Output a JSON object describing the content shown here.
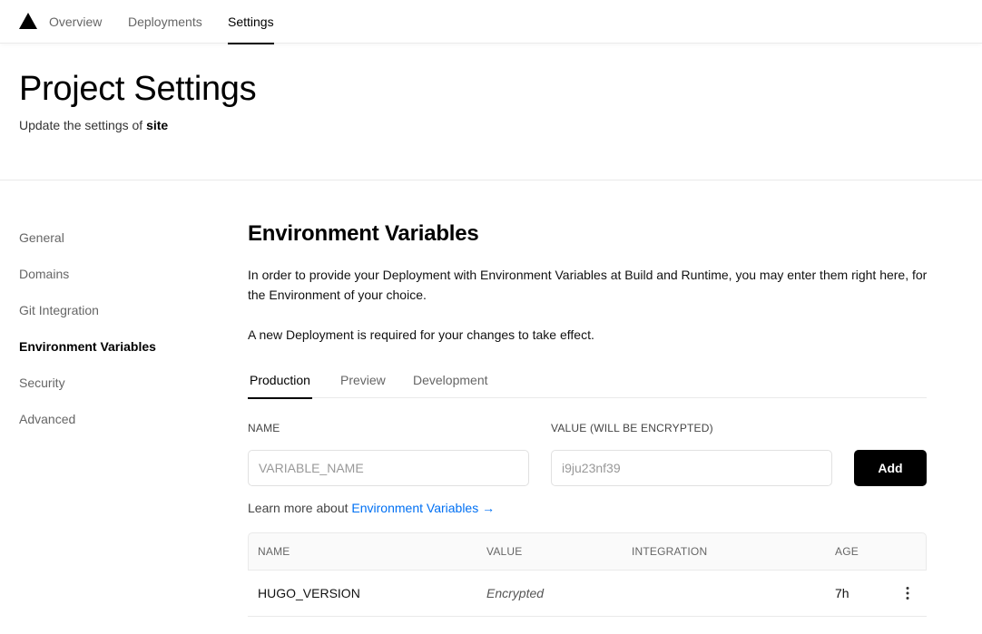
{
  "nav": {
    "tabs": [
      {
        "label": "Overview"
      },
      {
        "label": "Deployments"
      },
      {
        "label": "Settings",
        "active": true
      }
    ]
  },
  "header": {
    "title": "Project Settings",
    "subtitle_prefix": "Update the settings of ",
    "project_name": "site"
  },
  "sidebar": {
    "items": [
      {
        "label": "General"
      },
      {
        "label": "Domains"
      },
      {
        "label": "Git Integration"
      },
      {
        "label": "Environment Variables",
        "active": true
      },
      {
        "label": "Security"
      },
      {
        "label": "Advanced"
      }
    ]
  },
  "main": {
    "title": "Environment Variables",
    "description": "In order to provide your Deployment with Environment Variables at Build and Runtime, you may enter them right here, for the Environment of your choice.",
    "notice": "A new Deployment is required for your changes to take effect.",
    "env_tabs": [
      {
        "label": "Production",
        "active": true
      },
      {
        "label": "Preview"
      },
      {
        "label": "Development"
      }
    ],
    "form": {
      "name_label": "NAME",
      "name_placeholder": "VARIABLE_NAME",
      "value_label": "VALUE (WILL BE ENCRYPTED)",
      "value_placeholder": "i9ju23nf39",
      "add_label": "Add"
    },
    "learn_more": {
      "prefix": "Learn more about ",
      "link": "Environment Variables →"
    },
    "table": {
      "columns": [
        "NAME",
        "VALUE",
        "INTEGRATION",
        "AGE"
      ],
      "rows": [
        {
          "name": "HUGO_VERSION",
          "value": "Encrypted",
          "integration": "",
          "age": "7h"
        }
      ]
    }
  },
  "colors": {
    "accent_link": "#0070f3",
    "primary_button": "#000000",
    "border": "#eaeaea"
  },
  "icons": {
    "logo": "triangle-logo-icon",
    "row_menu": "more-vertical-icon"
  }
}
